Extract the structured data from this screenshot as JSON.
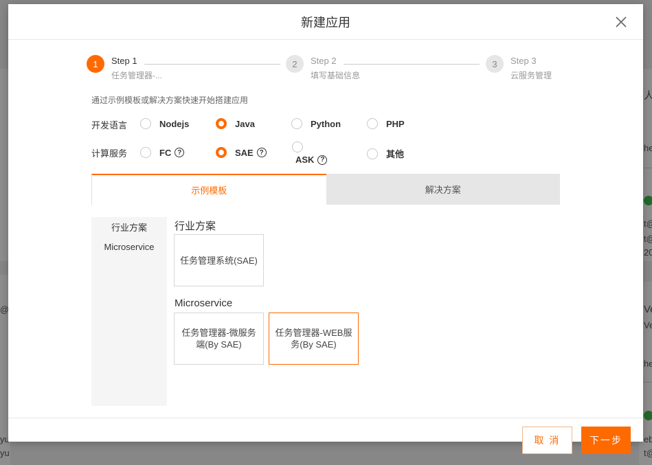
{
  "modal": {
    "title": "新建应用",
    "intro": "通过示例模板或解决方案快速开始搭建应用"
  },
  "steps": [
    {
      "num": "1",
      "title": "Step 1",
      "desc": "任务管理器-..."
    },
    {
      "num": "2",
      "title": "Step 2",
      "desc": "填写基础信息"
    },
    {
      "num": "3",
      "title": "Step 3",
      "desc": "云服务管理"
    }
  ],
  "language": {
    "label": "开发语言",
    "options": [
      "Nodejs",
      "Java",
      "Python",
      "PHP"
    ],
    "selected": "Java"
  },
  "compute": {
    "label": "计算服务",
    "options": [
      "FC",
      "SAE",
      "ASK",
      "其他"
    ],
    "selected": "SAE"
  },
  "tabs": [
    "示例模板",
    "解决方案"
  ],
  "sidebar": [
    "行业方案",
    "Microservice"
  ],
  "sections": [
    {
      "title": "行业方案",
      "cards": [
        "任务管理系统(SAE)"
      ]
    },
    {
      "title": "Microservice",
      "cards": [
        "任务管理器-微服务端(By SAE)",
        "任务管理器-WEB服务(By SAE)"
      ]
    }
  ],
  "footer": {
    "cancel": "取 消",
    "next": "下一步"
  },
  "colors": {
    "accent": "#ff6a00",
    "success": "#3bb54a"
  },
  "background_fragments": [
    "人脸",
    "t@",
    "t@",
    "20",
    "@",
    "Ve",
    "Veb",
    "he",
    "he",
    "yu",
    "yu",
    "eb",
    "t@",
    "t@"
  ]
}
